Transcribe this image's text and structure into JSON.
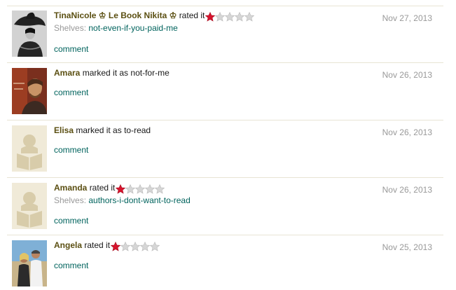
{
  "feed": {
    "items": [
      {
        "user": "TinaNicole ♔ Le Book Nikita ♔",
        "action": "rated it",
        "rating": 1,
        "max_rating": 5,
        "shelves_label": "Shelves:",
        "shelves": "not-even-if-you-paid-me",
        "comment": "comment",
        "date": "Nov 27, 2013",
        "avatar": "photo-hat-woman"
      },
      {
        "user": "Amara",
        "action": "marked it as not-for-me",
        "comment": "comment",
        "date": "Nov 26, 2013",
        "avatar": "photo-man"
      },
      {
        "user": "Elisa",
        "action": "marked it as to-read",
        "comment": "comment",
        "date": "Nov 26, 2013",
        "avatar": "default-reader-icon"
      },
      {
        "user": "Amanda",
        "action": "rated it",
        "rating": 1,
        "max_rating": 5,
        "shelves_label": "Shelves:",
        "shelves": "authors-i-dont-want-to-read",
        "comment": "comment",
        "date": "Nov 26, 2013",
        "avatar": "default-reader-icon"
      },
      {
        "user": "Angela",
        "action": "rated it",
        "rating": 1,
        "max_rating": 5,
        "comment": "comment",
        "date": "Nov 25, 2013",
        "avatar": "photo-couple"
      }
    ]
  },
  "colors": {
    "username": "#5b4f12",
    "link": "#00635d",
    "muted": "#999999",
    "star_on": "#d7142d",
    "star_off": "#d6d6d6",
    "separator": "#e8e4d4",
    "placeholder_bg": "#f0ead8",
    "placeholder_fg": "#d8ccaa"
  }
}
